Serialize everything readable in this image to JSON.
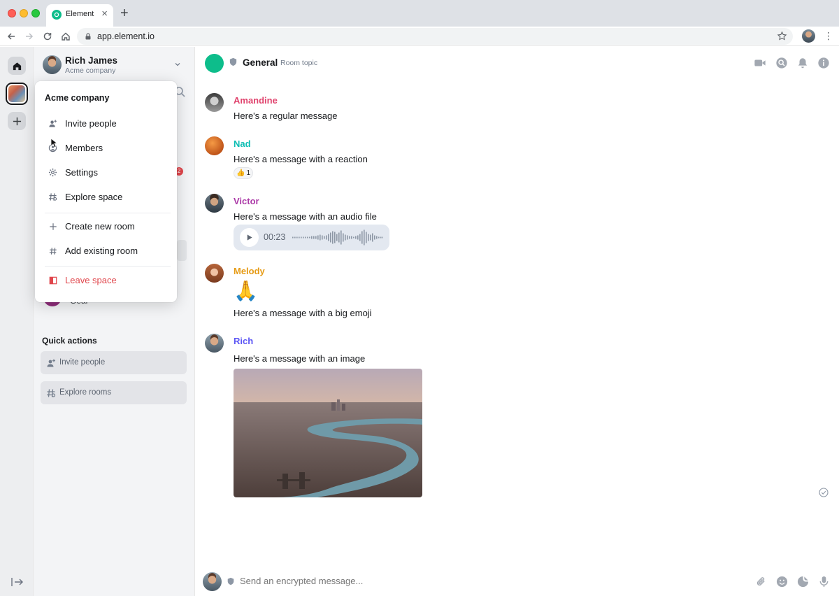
{
  "browser": {
    "tab_title": "Element",
    "tab_close": "×",
    "new_tab": "+",
    "url": "app.element.io",
    "menu": "⋮"
  },
  "user": {
    "name": "Rich James",
    "subtitle": "Acme company"
  },
  "room_list": {
    "hidden_badge": "2",
    "hidden_room_text": "Gear",
    "quick_actions_title": "Quick actions",
    "quick_actions": [
      {
        "label": "Invite people",
        "icon": "person-add-icon"
      },
      {
        "label": "Explore rooms",
        "icon": "explore-icon"
      }
    ]
  },
  "context_menu": {
    "title": "Acme company",
    "items": [
      {
        "label": "Invite people",
        "icon": "person-add-icon"
      },
      {
        "label": "Members",
        "icon": "members-icon"
      },
      {
        "label": "Settings",
        "icon": "gear-icon"
      },
      {
        "label": "Explore space",
        "icon": "explore-icon"
      },
      {
        "label": "Create new room",
        "icon": "plus-icon"
      },
      {
        "label": "Add existing room",
        "icon": "hash-icon"
      },
      {
        "label": "Leave space",
        "icon": "leave-icon"
      }
    ],
    "danger_color": "#e0464c"
  },
  "room": {
    "name": "General",
    "topic": "Room topic",
    "accent_color": "#0dbd8b"
  },
  "messages": [
    {
      "sender": "Amandine",
      "color": "#e0446e",
      "body": "Here's a regular message"
    },
    {
      "sender": "Nad",
      "color": "#0dbdb3",
      "body": "Here's a message with a reaction",
      "reaction": {
        "emoji": "👍",
        "count": "1"
      }
    },
    {
      "sender": "Victor",
      "color": "#ac3ba8",
      "body": "Here's a message with an audio file",
      "audio": {
        "duration": "00:23"
      }
    },
    {
      "sender": "Melody",
      "color": "#e69b15",
      "emoji": "🙏",
      "body": "Here's a message with a big emoji"
    },
    {
      "sender": "Rich",
      "color": "#5c56f5",
      "body": "Here's a message with an image"
    }
  ],
  "composer": {
    "placeholder": "Send an encrypted message..."
  }
}
